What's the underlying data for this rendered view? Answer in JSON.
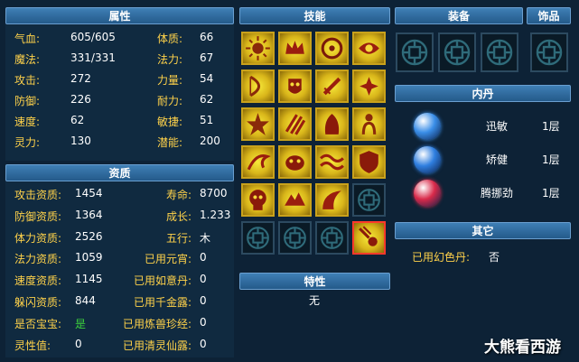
{
  "attributes": {
    "title": "属性",
    "left": [
      {
        "label": "气血:",
        "value": "605/605"
      },
      {
        "label": "魔法:",
        "value": "331/331"
      },
      {
        "label": "攻击:",
        "value": "272"
      },
      {
        "label": "防御:",
        "value": "226"
      },
      {
        "label": "速度:",
        "value": "62"
      },
      {
        "label": "灵力:",
        "value": "130"
      }
    ],
    "right": [
      {
        "label": "体质:",
        "value": "66"
      },
      {
        "label": "法力:",
        "value": "67"
      },
      {
        "label": "力量:",
        "value": "54"
      },
      {
        "label": "耐力:",
        "value": "62"
      },
      {
        "label": "敏捷:",
        "value": "51"
      },
      {
        "label": "潜能:",
        "value": "200"
      }
    ]
  },
  "aptitude": {
    "title": "资质",
    "left": [
      {
        "label": "攻击资质:",
        "value": "1454"
      },
      {
        "label": "防御资质:",
        "value": "1364"
      },
      {
        "label": "体力资质:",
        "value": "2526"
      },
      {
        "label": "法力资质:",
        "value": "1059"
      },
      {
        "label": "速度资质:",
        "value": "1145"
      },
      {
        "label": "躲闪资质:",
        "value": "844"
      },
      {
        "label": "是否宝宝:",
        "value": "是"
      },
      {
        "label": "灵性值:",
        "value": "0"
      }
    ],
    "right": [
      {
        "label": "寿命:",
        "value": "8700"
      },
      {
        "label": "成长:",
        "value": "1.233"
      },
      {
        "label": "五行:",
        "value": "木"
      },
      {
        "label": "已用元宵:",
        "value": "0"
      },
      {
        "label": "已用如意丹:",
        "value": "0"
      },
      {
        "label": "已用千金露:",
        "value": "0"
      },
      {
        "label": "已用炼兽珍经:",
        "value": "0"
      },
      {
        "label": "已用清灵仙露:",
        "value": "0"
      }
    ]
  },
  "skills": {
    "title": "技能",
    "icons": [
      "sun-skill-icon",
      "crown-skill-icon",
      "wheel-skill-icon",
      "eye-skill-icon",
      "bow-skill-icon",
      "mask-skill-icon",
      "sword-skill-icon",
      "lotus-skill-icon",
      "star-skill-icon",
      "claw-skill-icon",
      "hood-skill-icon",
      "figure-skill-icon",
      "dragon-skill-icon",
      "beast-skill-icon",
      "wave-skill-icon",
      "shield-skill-icon",
      "skull-skill-icon",
      "wolf-skill-icon",
      "wing-skill-icon",
      "empty-slot-icon",
      "empty-slot-icon",
      "empty-slot-icon",
      "empty-slot-icon",
      "meteor-skill-icon"
    ]
  },
  "traits": {
    "title": "特性",
    "value": "无"
  },
  "equipment": {
    "title": "装备",
    "slots": 3
  },
  "ornament": {
    "title": "饰品"
  },
  "inner_pill": {
    "title": "内丹",
    "items": [
      {
        "name": "迅敏",
        "level": "1层",
        "color": "#3a8ee8"
      },
      {
        "name": "矫健",
        "level": "1层",
        "color": "#2f7fe0"
      },
      {
        "name": "腾挪劲",
        "level": "1层",
        "color": "#d92a4a"
      }
    ]
  },
  "other": {
    "title": "其它",
    "label": "已用幻色丹:",
    "value": "否"
  },
  "watermark": "大熊看西游",
  "colors": {
    "label": "#ffd24a",
    "value": "#ffffff",
    "baby_yes": "#3cd13c",
    "header": "#2f6ea6"
  }
}
